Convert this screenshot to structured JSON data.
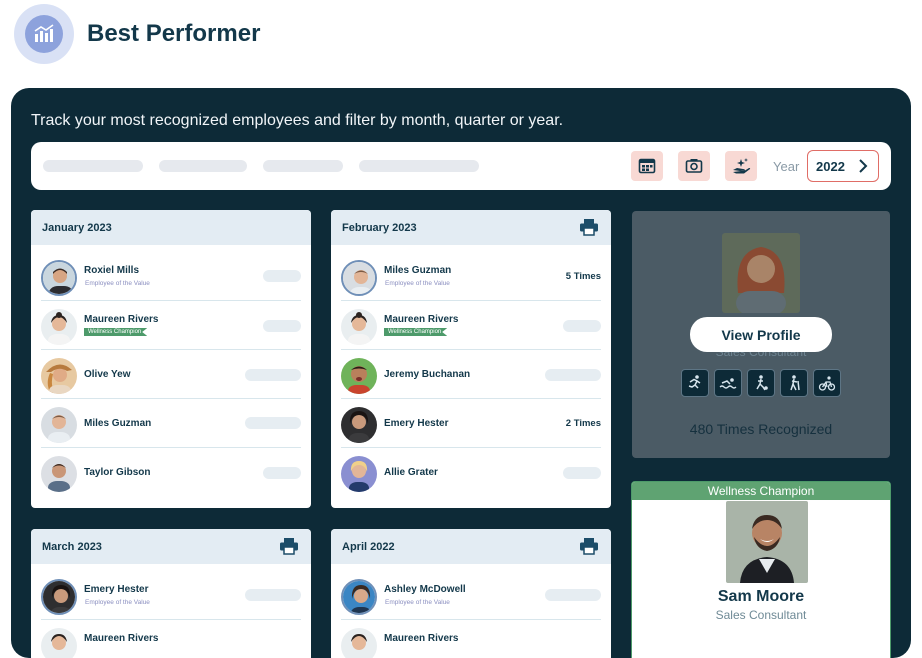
{
  "header": {
    "title": "Best Performer",
    "logo_icon": "bar-chart-icon"
  },
  "panel": {
    "description": "Track your most recognized employees and filter by month, quarter or year.",
    "filter": {
      "buttons": [
        "month-calendar-icon",
        "quarter-camera-icon",
        "year-hand-sparkle-icon"
      ],
      "year_label": "Year",
      "year_value": "2022"
    }
  },
  "cards": [
    {
      "title": "January 2023",
      "printable": false,
      "rows": [
        {
          "name": "Roxiel Mills",
          "sub": "Employee of the Value",
          "badge": "",
          "times": ""
        },
        {
          "name": "Maureen Rivers",
          "sub": "",
          "badge": "Wellness Champion",
          "times": ""
        },
        {
          "name": "Olive Yew",
          "sub": "",
          "badge": "",
          "times": ""
        },
        {
          "name": "Miles Guzman",
          "sub": "",
          "badge": "",
          "times": ""
        },
        {
          "name": "Taylor Gibson",
          "sub": "",
          "badge": "",
          "times": ""
        }
      ]
    },
    {
      "title": "February 2023",
      "printable": true,
      "rows": [
        {
          "name": "Miles Guzman",
          "sub": "Employee of the Value",
          "badge": "",
          "times": "5 Times"
        },
        {
          "name": "Maureen Rivers",
          "sub": "",
          "badge": "Wellness Champion",
          "times": ""
        },
        {
          "name": "Jeremy Buchanan",
          "sub": "",
          "badge": "",
          "times": ""
        },
        {
          "name": "Emery Hester",
          "sub": "",
          "badge": "",
          "times": "2 Times"
        },
        {
          "name": "Allie Grater",
          "sub": "",
          "badge": "",
          "times": ""
        }
      ]
    },
    {
      "title": "March 2023",
      "printable": true,
      "rows": [
        {
          "name": "Emery Hester",
          "sub": "Employee of the Value",
          "badge": "",
          "times": ""
        },
        {
          "name": "Maureen Rivers",
          "sub": "",
          "badge": "",
          "times": ""
        }
      ]
    },
    {
      "title": "April 2022",
      "printable": true,
      "rows": [
        {
          "name": "Ashley McDowell",
          "sub": "Employee of the Value",
          "badge": "",
          "times": ""
        },
        {
          "name": "Maureen Rivers",
          "sub": "",
          "badge": "",
          "times": ""
        }
      ]
    }
  ],
  "profile": {
    "button": "View Profile",
    "role": "Sales Consultant",
    "sports": [
      "running-icon",
      "swimming-icon",
      "soccer-icon",
      "hiking-icon",
      "cycling-icon"
    ],
    "times_recognized": "480 Times Recognized"
  },
  "wellness": {
    "title": "Wellness Champion",
    "name": "Sam Moore",
    "role": "Sales Consultant"
  },
  "colors": {
    "panel_bg": "#0d2a37",
    "accent_navy": "#13384a",
    "badge_green": "#4d9a6a",
    "filter_btn": "#f8d9d4",
    "year_border": "#e06d66"
  }
}
